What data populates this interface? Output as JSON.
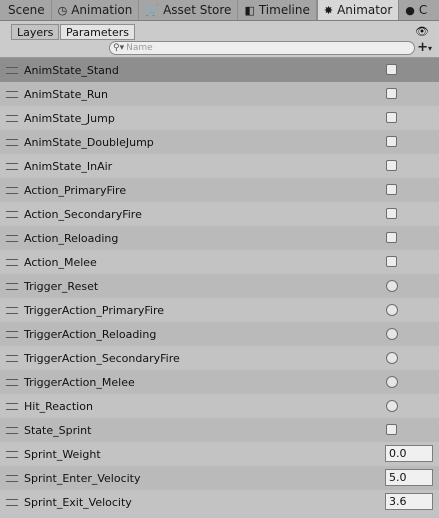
{
  "window_tabs": [
    {
      "label": "Scene",
      "icon": "scene-icon"
    },
    {
      "label": "Animation",
      "icon": "clock-icon"
    },
    {
      "label": "Asset Store",
      "icon": "cart-icon"
    },
    {
      "label": "Timeline",
      "icon": "timeline-icon"
    },
    {
      "label": "Animator",
      "icon": "animator-icon"
    },
    {
      "label": "C",
      "icon": "console-icon"
    }
  ],
  "subtabs": {
    "layers": "Layers",
    "parameters": "Parameters"
  },
  "search": {
    "placeholder": "Name"
  },
  "parameters": [
    {
      "name": "AnimState_Stand",
      "type": "bool",
      "value": ""
    },
    {
      "name": "AnimState_Run",
      "type": "bool",
      "value": ""
    },
    {
      "name": "AnimState_Jump",
      "type": "bool",
      "value": ""
    },
    {
      "name": "AnimState_DoubleJump",
      "type": "bool",
      "value": ""
    },
    {
      "name": "AnimState_InAir",
      "type": "bool",
      "value": ""
    },
    {
      "name": "Action_PrimaryFire",
      "type": "bool",
      "value": ""
    },
    {
      "name": "Action_SecondaryFire",
      "type": "bool",
      "value": ""
    },
    {
      "name": "Action_Reloading",
      "type": "bool",
      "value": ""
    },
    {
      "name": "Action_Melee",
      "type": "bool",
      "value": ""
    },
    {
      "name": "Trigger_Reset",
      "type": "trigger",
      "value": ""
    },
    {
      "name": "TriggerAction_PrimaryFire",
      "type": "trigger",
      "value": ""
    },
    {
      "name": "TriggerAction_Reloading",
      "type": "trigger",
      "value": ""
    },
    {
      "name": "TriggerAction_SecondaryFire",
      "type": "trigger",
      "value": ""
    },
    {
      "name": "TriggerAction_Melee",
      "type": "trigger",
      "value": ""
    },
    {
      "name": "Hit_Reaction",
      "type": "trigger",
      "value": ""
    },
    {
      "name": "State_Sprint",
      "type": "bool",
      "value": ""
    },
    {
      "name": "Sprint_Weight",
      "type": "float",
      "value": "0.0"
    },
    {
      "name": "Sprint_Enter_Velocity",
      "type": "float",
      "value": "5.0"
    },
    {
      "name": "Sprint_Exit_Velocity",
      "type": "float",
      "value": "3.6"
    }
  ]
}
